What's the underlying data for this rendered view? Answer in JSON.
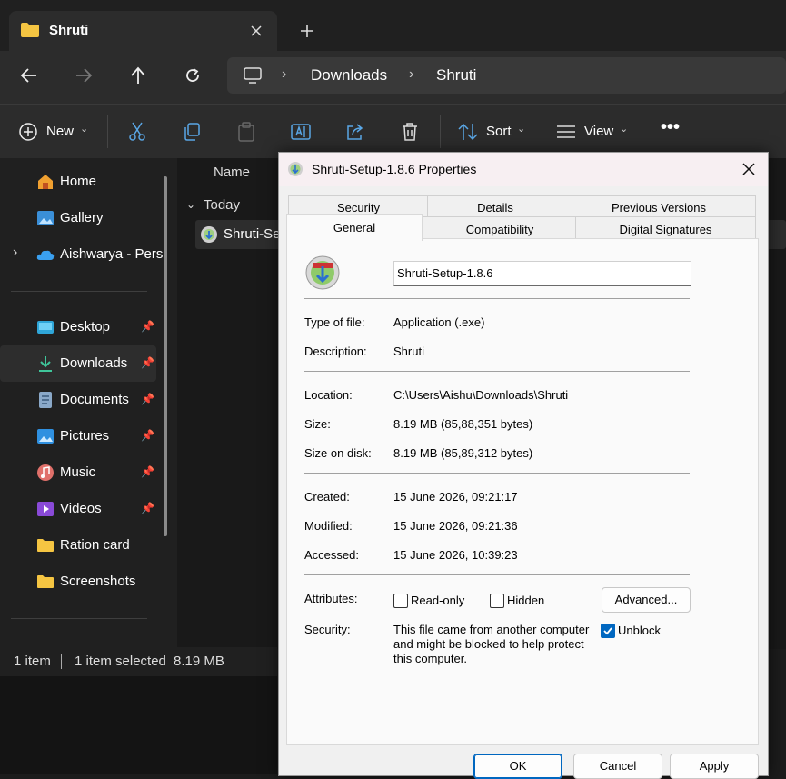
{
  "explorer": {
    "tab_title": "Shruti",
    "breadcrumb": [
      "Downloads",
      "Shruti"
    ],
    "toolbar": {
      "new_label": "New",
      "sort_label": "Sort",
      "view_label": "View"
    },
    "nav": {
      "home": "Home",
      "gallery": "Gallery",
      "onedrive": "Aishwarya - Pers",
      "desktop": "Desktop",
      "downloads": "Downloads",
      "documents": "Documents",
      "pictures": "Pictures",
      "music": "Music",
      "videos": "Videos",
      "ration": "Ration card",
      "screenshots": "Screenshots"
    },
    "column_name": "Name",
    "group_today": "Today",
    "file_name": "Shruti-Se",
    "status": {
      "count": "1 item",
      "selected": "1 item selected",
      "size": "8.19 MB"
    }
  },
  "dialog": {
    "title": "Shruti-Setup-1.8.6 Properties",
    "tabs": {
      "security": "Security",
      "details": "Details",
      "previous": "Previous Versions",
      "general": "General",
      "compat": "Compatibility",
      "digsig": "Digital Signatures"
    },
    "filename": "Shruti-Setup-1.8.6",
    "rows": {
      "type_label": "Type of file:",
      "type_value": "Application (.exe)",
      "desc_label": "Description:",
      "desc_value": "Shruti",
      "loc_label": "Location:",
      "loc_value": "C:\\Users\\Aishu\\Downloads\\Shruti",
      "size_label": "Size:",
      "size_value": "8.19 MB (85,88,351 bytes)",
      "disk_label": "Size on disk:",
      "disk_value": "8.19 MB (85,89,312 bytes)",
      "created_label": "Created:",
      "created_value": "15 June 2026, 09:21:17",
      "modified_label": "Modified:",
      "modified_value": "15 June 2026, 09:21:36",
      "accessed_label": "Accessed:",
      "accessed_value": "15 June 2026, 10:39:23",
      "attr_label": "Attributes:",
      "readonly": "Read-only",
      "hidden": "Hidden",
      "advanced": "Advanced...",
      "security_label": "Security:",
      "security_text_1": "This file came from another computer",
      "security_text_2": "and might be blocked to help protect",
      "security_text_3": "this computer.",
      "unblock": "Unblock"
    },
    "buttons": {
      "ok": "OK",
      "cancel": "Cancel",
      "apply": "Apply"
    }
  }
}
